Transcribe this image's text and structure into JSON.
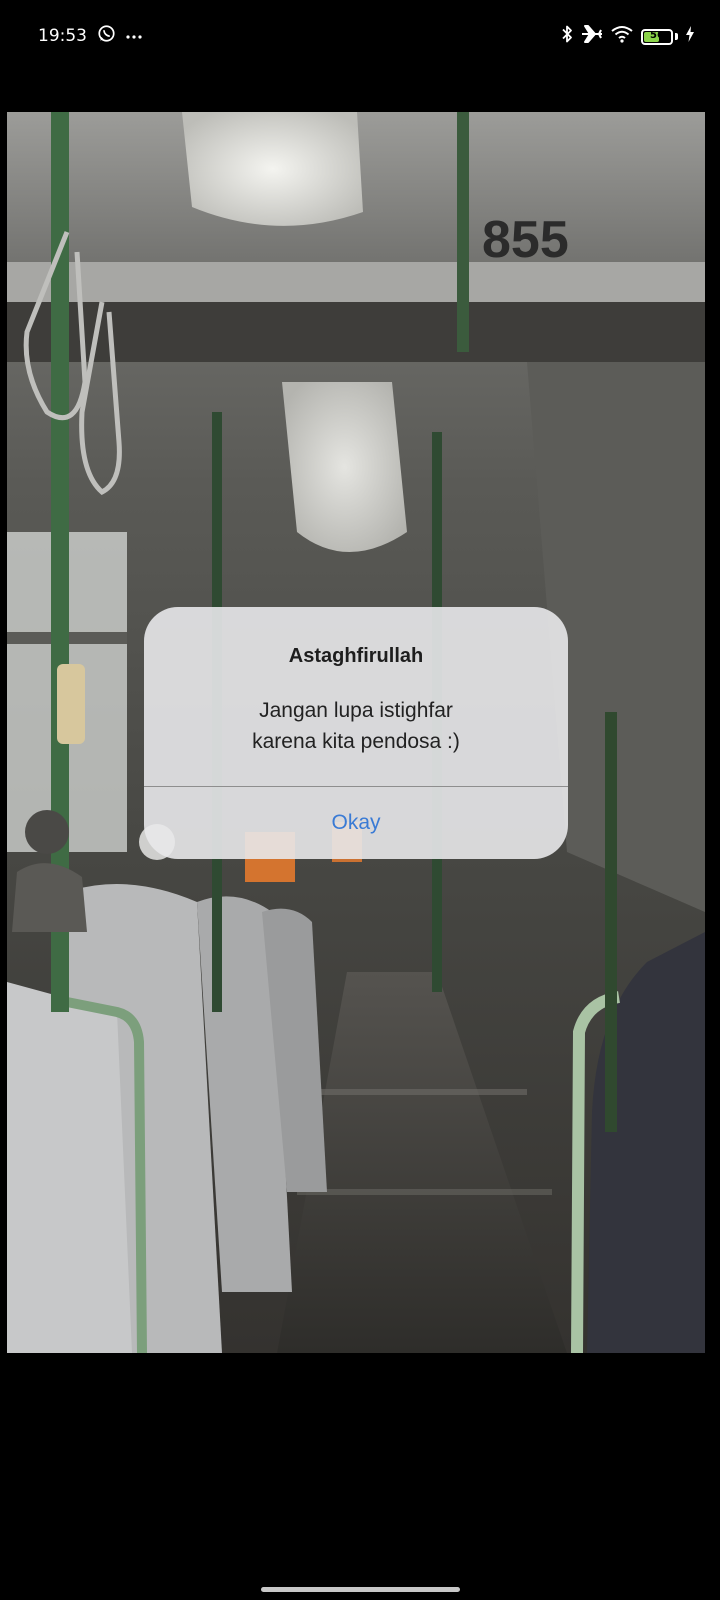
{
  "status_bar": {
    "time": "19:53",
    "notification_icons": [
      "whatsapp-icon",
      "more-dots-icon"
    ],
    "system_icons": [
      "bluetooth-icon",
      "airplane-mode-icon",
      "wifi-icon",
      "battery-icon",
      "charging-icon"
    ],
    "battery_level": "56",
    "battery_color": "#8bd34a"
  },
  "background_photo": {
    "bus_number": "855"
  },
  "dialog": {
    "title": "Astaghfirullah",
    "message_line1": "Jangan lupa istighfar",
    "message_line2": "karena kita pendosa :)",
    "button_label": "Okay",
    "button_color": "#3a7bd5"
  }
}
